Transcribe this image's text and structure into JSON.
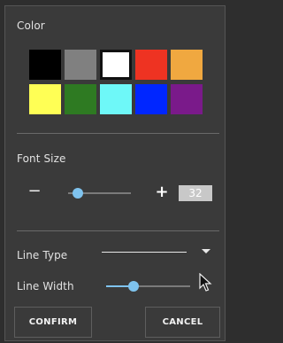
{
  "color_section": {
    "label": "Color",
    "swatches": [
      {
        "name": "black",
        "hex": "#000000"
      },
      {
        "name": "gray",
        "hex": "#808080"
      },
      {
        "name": "white",
        "hex": "#ffffff",
        "selected": true
      },
      {
        "name": "red",
        "hex": "#ee3322"
      },
      {
        "name": "orange",
        "hex": "#f0a840"
      },
      {
        "name": "yellow",
        "hex": "#ffff55"
      },
      {
        "name": "green",
        "hex": "#2e7a22"
      },
      {
        "name": "cyan",
        "hex": "#6ef8f8"
      },
      {
        "name": "blue",
        "hex": "#0026ff"
      },
      {
        "name": "purple",
        "hex": "#7a1a8a"
      }
    ]
  },
  "font_size": {
    "label": "Font Size",
    "minus": "−",
    "plus": "+",
    "value": "32",
    "slider_fraction": 0.15
  },
  "line_type": {
    "label": "Line Type",
    "dropdown_icon": "triangle-down"
  },
  "line_width": {
    "label": "Line Width",
    "slider_fraction": 0.33
  },
  "buttons": {
    "confirm": "CONFIRM",
    "cancel": "CANCEL"
  },
  "colors": {
    "accent": "#7fc3ee",
    "panel": "#3a3a3a",
    "text": "#e2e2e2"
  }
}
